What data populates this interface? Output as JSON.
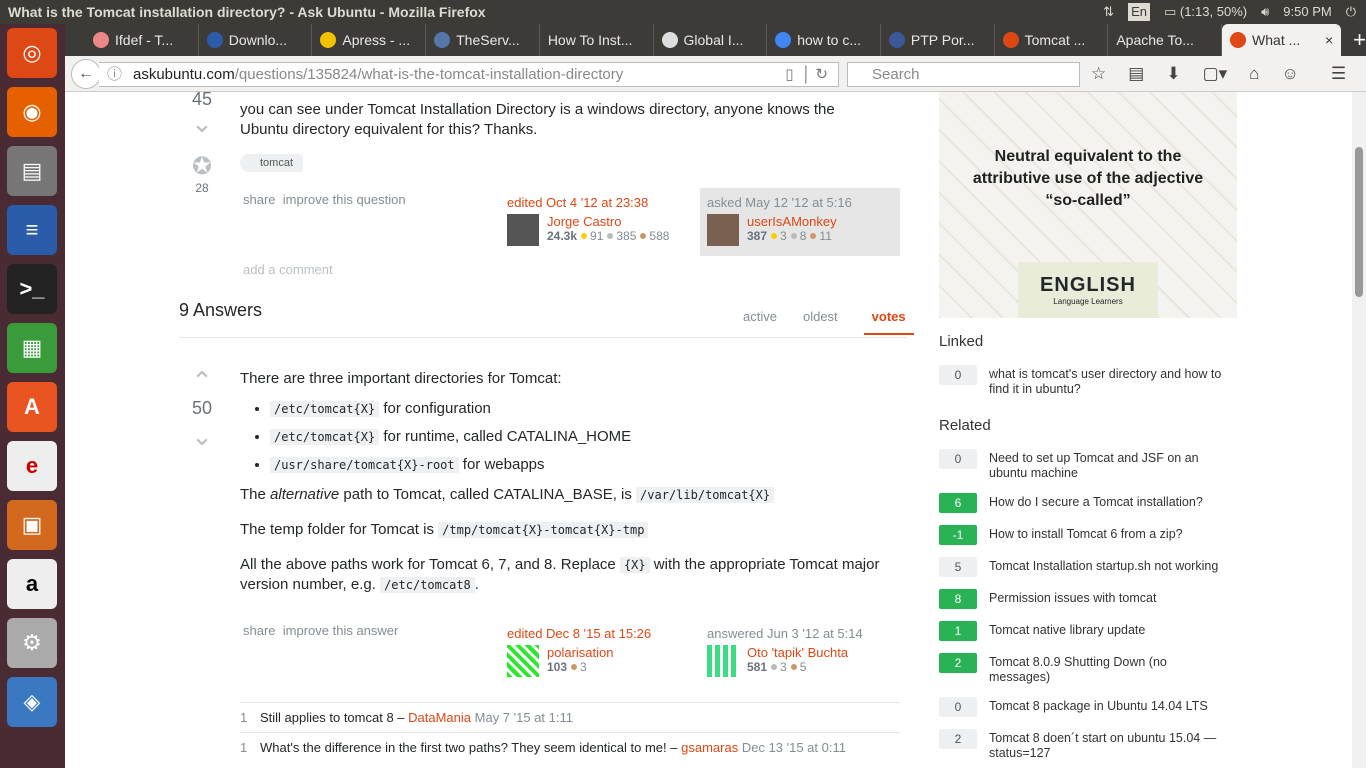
{
  "window": {
    "title": "What is the Tomcat installation directory? - Ask Ubuntu - Mozilla Firefox"
  },
  "tray": {
    "lang": "En",
    "battery": "(1:13, 50%)",
    "time": "9:50 PM"
  },
  "tabs": [
    {
      "label": "Ifdef - T...",
      "color": "#e88"
    },
    {
      "label": "Downlo...",
      "color": "#2a5caa"
    },
    {
      "label": "Apress - ...",
      "color": "#f2c200"
    },
    {
      "label": "TheServ...",
      "color": "#5577aa"
    },
    {
      "label": "How To Inst..."
    },
    {
      "label": "Global I...",
      "color": "#ddd"
    },
    {
      "label": "how to c...",
      "color": "#4285f4"
    },
    {
      "label": "PTP Por...",
      "color": "#3b5998"
    },
    {
      "label": "Tomcat ...",
      "color": "#dd4814"
    },
    {
      "label": "Apache To..."
    },
    {
      "label": "What ...",
      "color": "#dd4814",
      "active": true
    }
  ],
  "nav": {
    "url_host": "askubuntu.com",
    "url_path": "/questions/135824/what-is-the-tomcat-installation-directory",
    "search_placeholder": "Search"
  },
  "question": {
    "votes": "45",
    "favorites": "28",
    "body_lines": [
      "you can see under Tomcat Installation Directory is a windows directory, anyone knows the",
      "Ubuntu directory equivalent for this? Thanks."
    ],
    "tag": "tomcat",
    "share": "share",
    "improve": "improve this question",
    "edited": "edited Oct 4 '12 at 23:38",
    "editor": {
      "name": "Jorge Castro",
      "rep": "24.3k",
      "gold": "91",
      "silver": "385",
      "bronze": "588"
    },
    "asked": "asked May 12 '12 at 5:16",
    "asker": {
      "name": "userIsAMonkey",
      "rep": "387",
      "gold": "3",
      "silver": "8",
      "bronze": "11"
    },
    "add_comment": "add a comment"
  },
  "answers_header": {
    "count": "9 Answers",
    "tabs": [
      "active",
      "oldest",
      "votes"
    ]
  },
  "answer": {
    "votes": "50",
    "intro": "There are three important directories for Tomcat:",
    "list": [
      {
        "code": "/etc/tomcat{X}",
        "text": "for configuration"
      },
      {
        "code": "/etc/tomcat{X}",
        "text": "for runtime, called CATALINA_HOME"
      },
      {
        "code": "/usr/share/tomcat{X}-root",
        "text": "for webapps"
      }
    ],
    "p1_a": "The ",
    "p1_em": "alternative",
    "p1_b": " path to Tomcat, called CATALINA_BASE, is ",
    "p1_code": "/var/lib/tomcat{X}",
    "p2": "The temp folder for Tomcat is ",
    "p2_code": "/tmp/tomcat{X}-tomcat{X}-tmp",
    "p3_a": "All the above paths work for Tomcat 6, 7, and 8. Replace ",
    "p3_code": "{X}",
    "p3_b": " with the appropriate Tomcat major",
    "p3_c": "version number, e.g. ",
    "p3_code2": "/etc/tomcat8",
    "p3_d": ".",
    "share": "share",
    "improve": "improve this answer",
    "edited": "edited Dec 8 '15 at 15:26",
    "editor": {
      "name": "polarisation",
      "rep": "103",
      "bronze": "3"
    },
    "answered": "answered Jun 3 '12 at 5:14",
    "author": {
      "name": "Oto 'tapik' Buchta",
      "rep": "581",
      "silver": "3",
      "bronze": "5"
    },
    "comments": [
      {
        "score": "1",
        "text": "Still applies to tomcat 8 – ",
        "user": "DataMania",
        "date": "May 7 '15 at 1:11"
      },
      {
        "score": "1",
        "text": "What's the difference in the first two paths? They seem identical to me! – ",
        "user": "gsamaras",
        "date": "Dec 13 '15 at 0:11"
      }
    ]
  },
  "ad": {
    "headline": "Neutral equivalent to the attributive use of the adjective “so-called”",
    "logo": "ENGLISH",
    "logo_sub": "Language Learners"
  },
  "linked": {
    "title": "Linked",
    "items": [
      {
        "score": "0",
        "text": "what is tomcat's user directory and how to find it in ubuntu?"
      }
    ]
  },
  "related": {
    "title": "Related",
    "items": [
      {
        "score": "0",
        "text": "Need to set up Tomcat and JSF on an ubuntu machine",
        "answered": false
      },
      {
        "score": "6",
        "text": "How do I secure a Tomcat installation?",
        "answered": true
      },
      {
        "score": "-1",
        "text": "How to install Tomcat 6 from a zip?",
        "answered": true
      },
      {
        "score": "5",
        "text": "Tomcat Installation startup.sh not working",
        "answered": false
      },
      {
        "score": "8",
        "text": "Permission issues with tomcat",
        "answered": true
      },
      {
        "score": "1",
        "text": "Tomcat native library update",
        "answered": true
      },
      {
        "score": "2",
        "text": "Tomcat 8.0.9 Shutting Down (no messages)",
        "answered": true
      },
      {
        "score": "0",
        "text": "Tomcat 8 package in Ubuntu 14.04 LTS",
        "answered": false
      },
      {
        "score": "2",
        "text": "Tomcat 8 doen´t start on ubuntu 15.04 — status=127",
        "answered": false
      }
    ]
  }
}
